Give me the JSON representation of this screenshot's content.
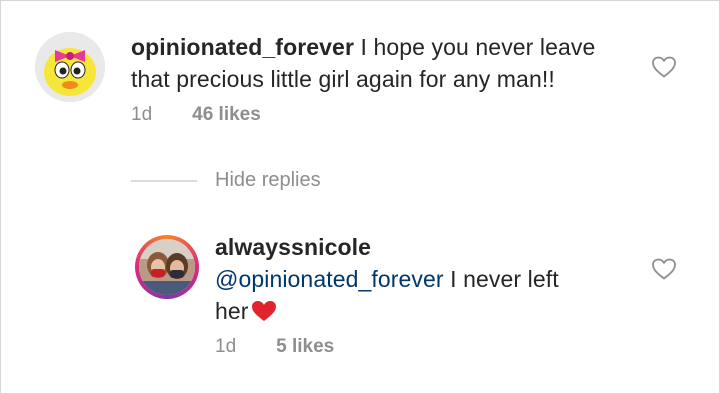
{
  "comment": {
    "username": "opinionated_forever",
    "text": "I hope you never leave that precious little girl again for any man!!",
    "age": "1d",
    "likes": "46 likes"
  },
  "replies_toggle": "Hide replies",
  "reply": {
    "username": "alwayssnicole",
    "mention": "@opinionated_forever",
    "text_part1": "I never left",
    "text_part2": "her",
    "age": "1d",
    "likes": "5 likes"
  },
  "icons": {
    "like": "heart-outline-icon",
    "emoji": "red-heart-emoji"
  },
  "colors": {
    "text": "#262626",
    "meta": "#8e8e8e",
    "mention": "#00376b",
    "heart_emoji": "#e0242c"
  }
}
